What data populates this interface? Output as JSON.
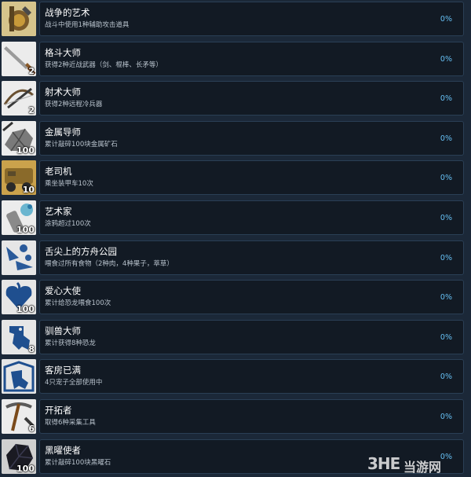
{
  "achievements": [
    {
      "title": "战争的艺术",
      "desc": "战斗中使用1种辅助攻击道具",
      "percent": "0%",
      "badge": "",
      "icon": "war-art-icon",
      "bg": "#cbb98a"
    },
    {
      "title": "格斗大师",
      "desc": "获得2种近战武器（剑、棍棒、长矛等）",
      "percent": "0%",
      "badge": "2",
      "icon": "melee-weapon-icon",
      "bg": "#e9e9e9"
    },
    {
      "title": "射术大师",
      "desc": "获得2种远程冷兵器",
      "percent": "0%",
      "badge": "2",
      "icon": "crossbow-icon",
      "bg": "#e9e9e9"
    },
    {
      "title": "金属导师",
      "desc": "累计敲碎100块金属矿石",
      "percent": "0%",
      "badge": "100",
      "icon": "metal-ore-icon",
      "bg": "#e9e9e9"
    },
    {
      "title": "老司机",
      "desc": "乘坐装甲车10次",
      "percent": "0%",
      "badge": "10",
      "icon": "armored-vehicle-icon",
      "bg": "#c9a24a"
    },
    {
      "title": "艺术家",
      "desc": "涂鸦超过100次",
      "percent": "0%",
      "badge": "100",
      "icon": "spray-can-icon",
      "bg": "#e9e9e9"
    },
    {
      "title": "舌尖上的方舟公园",
      "desc": "喂食过所有食物（2种肉，4种果子，萃草）",
      "percent": "0%",
      "badge": "",
      "icon": "food-icon",
      "bg": "#e9e9e9"
    },
    {
      "title": "爱心大使",
      "desc": "累计给恐龙喂食100次",
      "percent": "0%",
      "badge": "100",
      "icon": "heart-feed-icon",
      "bg": "#e9e9e9"
    },
    {
      "title": "驯兽大师",
      "desc": "累计获得8种恐龙",
      "percent": "0%",
      "badge": "8",
      "icon": "dinosaur-tame-icon",
      "bg": "#e9e9e9"
    },
    {
      "title": "客房已满",
      "desc": "4只宠子全部使用中",
      "percent": "0%",
      "badge": "",
      "icon": "dinosaur-house-icon",
      "bg": "#e9e9e9"
    },
    {
      "title": "开拓者",
      "desc": "取得6种采集工具",
      "percent": "0%",
      "badge": "6",
      "icon": "pickaxe-icon",
      "bg": "#e9e9e9"
    },
    {
      "title": "黑曜使者",
      "desc": "累计敲碎100块黑曜石",
      "percent": "0%",
      "badge": "100",
      "icon": "obsidian-icon",
      "bg": "#e9e9e9"
    }
  ],
  "watermark": {
    "logo": "3HE",
    "text": "当游网"
  }
}
